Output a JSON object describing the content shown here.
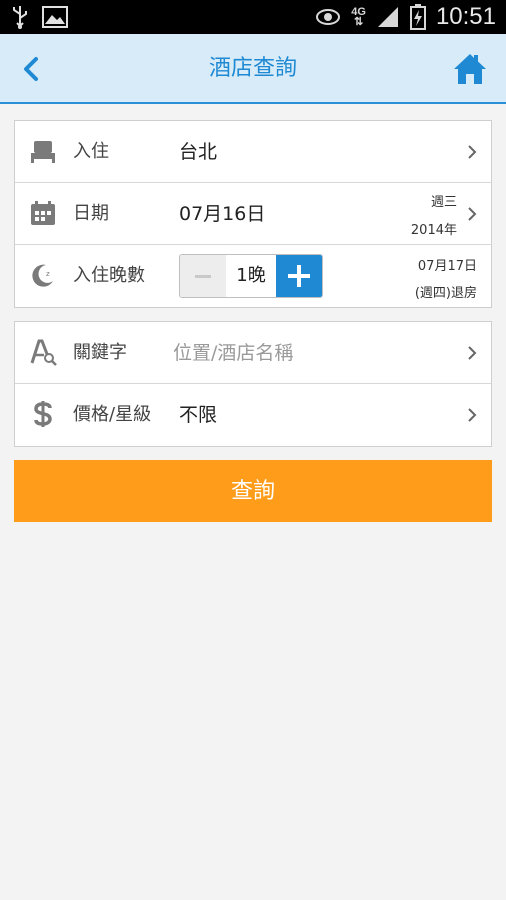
{
  "status_bar": {
    "time": "10:51",
    "network": "4G",
    "icons": [
      "usb-icon",
      "image-icon",
      "eye-icon",
      "signal-icon",
      "battery-charging-icon"
    ]
  },
  "header": {
    "title": "酒店查詢",
    "icons": [
      "back-icon",
      "home-icon"
    ]
  },
  "form": {
    "checkin": {
      "label": "入住",
      "value": "台北",
      "icon": "bed-icon"
    },
    "date": {
      "label": "日期",
      "value": "07月16日",
      "weekday": "週三",
      "year": "2014年",
      "icon": "calendar-icon"
    },
    "nights": {
      "label": "入住晚數",
      "count": "1晚",
      "checkout_date": "07月17日",
      "checkout_note": "(週四)退房",
      "icon": "moon-icon"
    }
  },
  "filters": {
    "keyword": {
      "label": "關鍵字",
      "placeholder": "位置/酒店名稱",
      "icon": "keyword-search-icon"
    },
    "price": {
      "label": "價格/星級",
      "value": "不限",
      "icon": "dollar-icon"
    }
  },
  "search_button": {
    "label": "查詢"
  },
  "colors": {
    "accent": "#1f8ad3",
    "header_bg": "#d7ebf8",
    "button": "#ff9c1a",
    "background": "#f3f3f3"
  }
}
